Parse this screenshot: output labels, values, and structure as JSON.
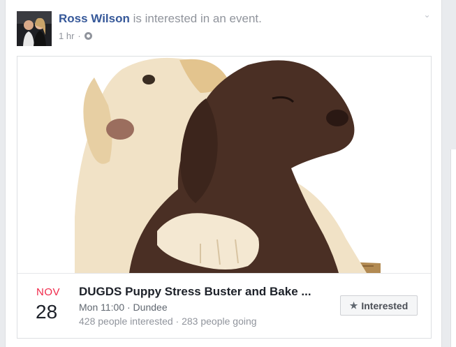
{
  "post": {
    "author_name": "Ross Wilson",
    "action_text": "is interested in an event.",
    "time": "1 hr",
    "separator": "·",
    "privacy_icon": "globe-icon",
    "options_icon": "chevron-down-icon"
  },
  "event": {
    "month": "NOV",
    "day": "28",
    "title": "DUGDS Puppy Stress Buster and Bake ...",
    "when": "Mon 11:00 · Dundee",
    "stats": "428 people interested · 283 people going",
    "button_icon": "star-icon",
    "button_label": "Interested"
  },
  "colors": {
    "link": "#365899",
    "month": "#f02849",
    "muted": "#90949c"
  }
}
